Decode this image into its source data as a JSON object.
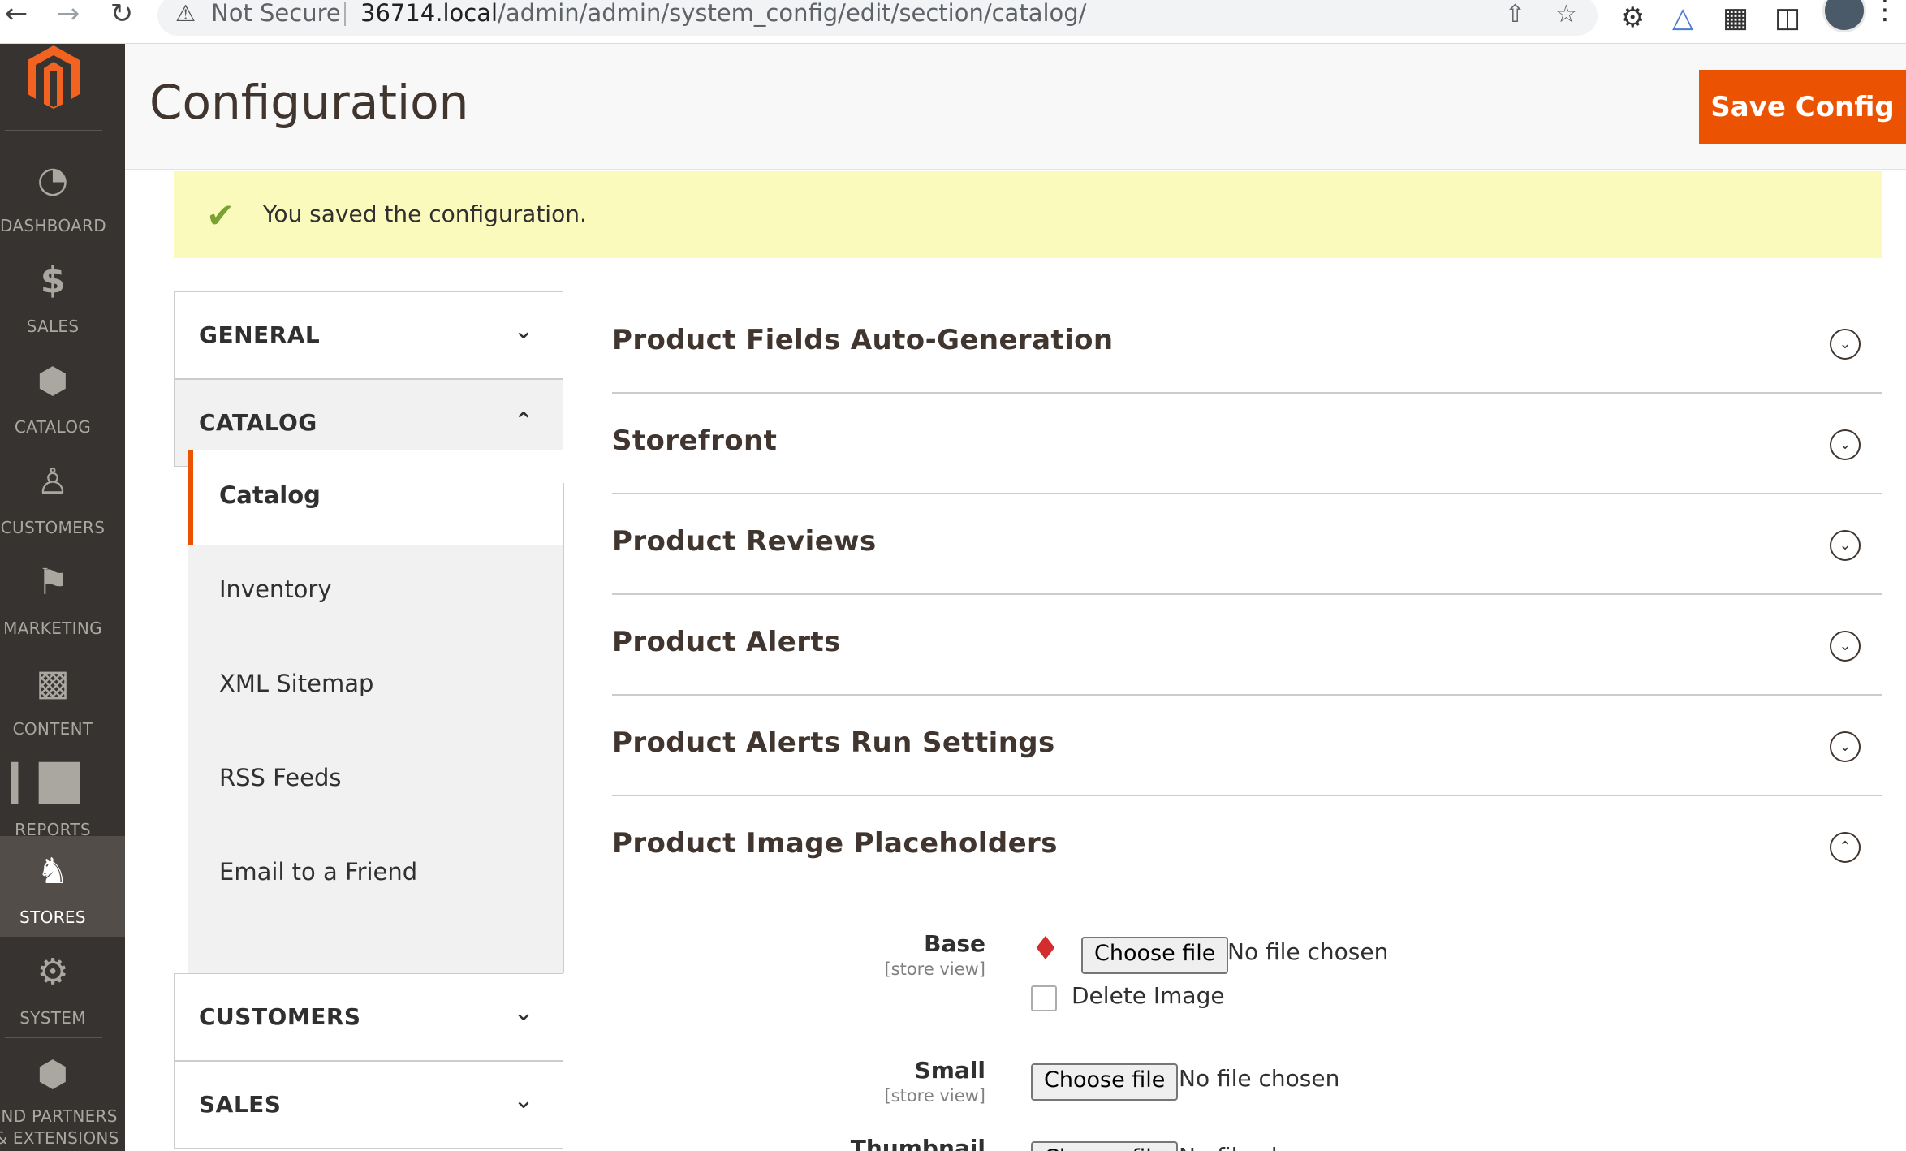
{
  "browser": {
    "security": "Not Secure",
    "url_host": "36714.local",
    "url_path": "/admin/admin/system_config/edit/section/catalog/"
  },
  "sidebar": {
    "items": [
      {
        "label": "DASHBOARD",
        "icon": "dashboard-icon"
      },
      {
        "label": "SALES",
        "icon": "dollar-icon"
      },
      {
        "label": "CATALOG",
        "icon": "cube-icon"
      },
      {
        "label": "CUSTOMERS",
        "icon": "person-icon"
      },
      {
        "label": "MARKETING",
        "icon": "megaphone-icon"
      },
      {
        "label": "CONTENT",
        "icon": "layout-icon"
      },
      {
        "label": "REPORTS",
        "icon": "bar-chart-icon"
      },
      {
        "label": "STORES",
        "icon": "store-icon"
      },
      {
        "label": "SYSTEM",
        "icon": "gear-icon"
      },
      {
        "label": "IND PARTNERS\n& EXTENSIONS",
        "icon": "boxes-icon"
      }
    ],
    "active": "STORES"
  },
  "header": {
    "title": "Configuration",
    "save_label": "Save Config"
  },
  "message": {
    "text": "You saved the configuration."
  },
  "tabs": {
    "general": "GENERAL",
    "catalog": "CATALOG",
    "customers": "CUSTOMERS",
    "sales": "SALES",
    "catalog_items": [
      "Catalog",
      "Inventory",
      "XML Sitemap",
      "RSS Feeds",
      "Email to a Friend"
    ]
  },
  "sections": [
    "Product Fields Auto-Generation",
    "Storefront",
    "Product Reviews",
    "Product Alerts",
    "Product Alerts Run Settings",
    "Product Image Placeholders"
  ],
  "form": {
    "base_label": "Base",
    "small_label": "Small",
    "thumbnail_label": "Thumbnail",
    "scope": "[store view]",
    "choose_file": "Choose file",
    "no_file": "No file chosen",
    "delete_image": "Delete Image"
  },
  "colors": {
    "accent": "#eb5202",
    "sidebar_bg": "#373330",
    "message_bg": "#fafabc",
    "success": "#79a22e"
  }
}
